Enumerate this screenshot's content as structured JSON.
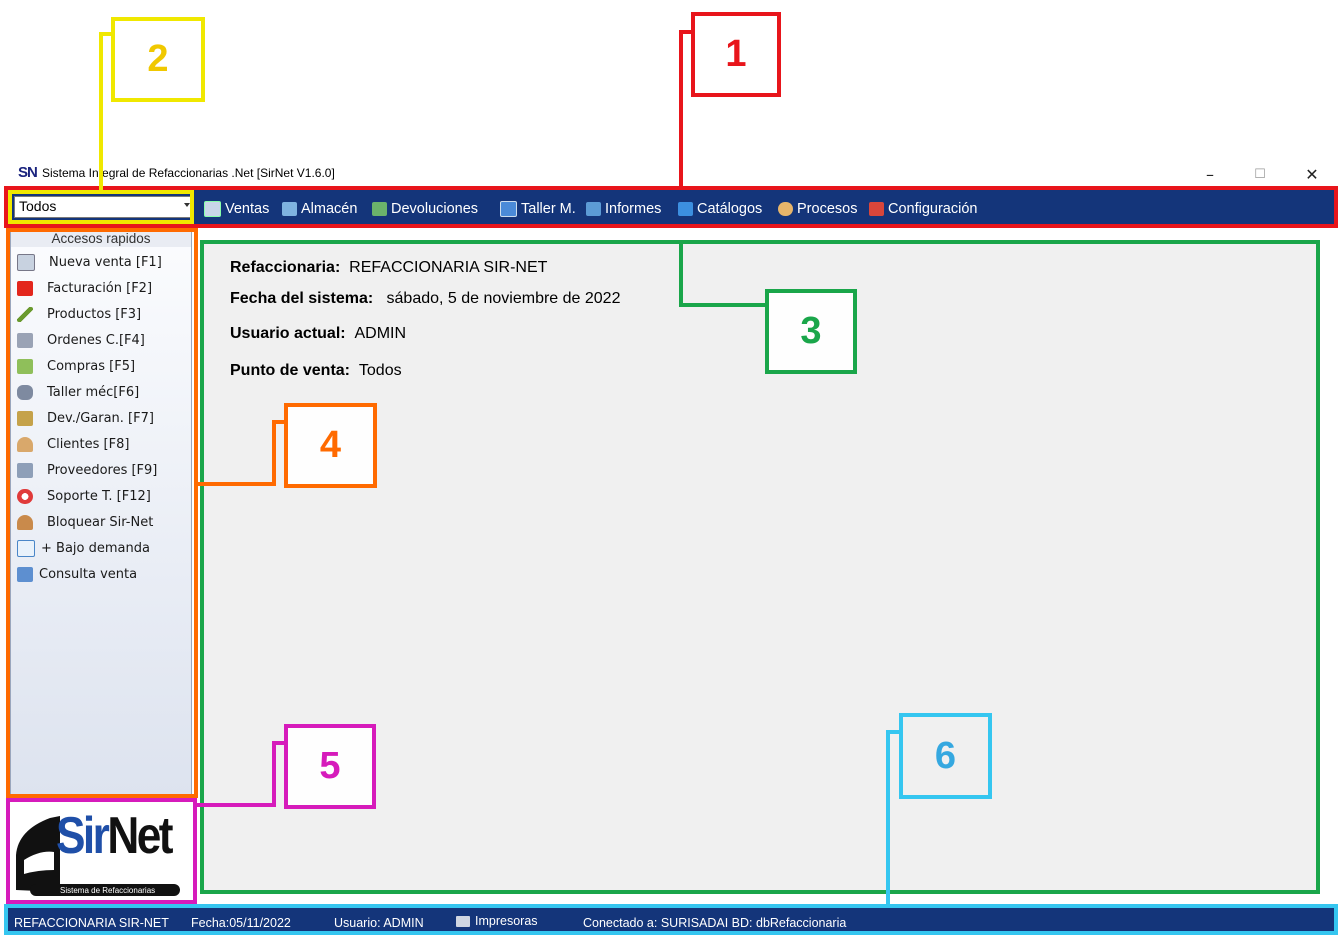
{
  "window": {
    "logo": "SN",
    "title": "Sistema Integral de Refaccionarias .Net [SirNet V1.6.0]",
    "controls": {
      "minimize": "–",
      "maximize": "☐",
      "close": "✕"
    }
  },
  "menubar": {
    "pos_selector": "Todos",
    "items": [
      {
        "label": "Ventas",
        "icon": "ventas-icon"
      },
      {
        "label": "Almacén",
        "icon": "almacen-icon"
      },
      {
        "label": "Devoluciones",
        "icon": "devoluciones-icon"
      },
      {
        "label": "Taller M.",
        "icon": "taller-icon"
      },
      {
        "label": "Informes",
        "icon": "informes-icon"
      },
      {
        "label": "Catálogos",
        "icon": "catalogos-icon"
      },
      {
        "label": "Procesos",
        "icon": "procesos-icon"
      },
      {
        "label": "Configuración",
        "icon": "configuracion-icon"
      }
    ]
  },
  "sidebar": {
    "header": "Accesos rapidos",
    "items": [
      {
        "label": "Nueva venta [F1]",
        "icon": "nueva-venta-icon"
      },
      {
        "label": "Facturación [F2]",
        "icon": "pdf-icon"
      },
      {
        "label": "Productos [F3]",
        "icon": "wrench-icon"
      },
      {
        "label": "Ordenes C.[F4]",
        "icon": "cart-icon"
      },
      {
        "label": "Compras [F5]",
        "icon": "compras-icon"
      },
      {
        "label": "Taller méc[F6]",
        "icon": "car-icon"
      },
      {
        "label": "Dev./Garan. [F7]",
        "icon": "return-cart-icon"
      },
      {
        "label": "Clientes [F8]",
        "icon": "user-icon"
      },
      {
        "label": "Proveedores [F9]",
        "icon": "supplier-icon"
      },
      {
        "label": "Soporte T. [F12]",
        "icon": "lifebuoy-icon"
      },
      {
        "label": "Bloquear Sir-Net",
        "icon": "lock-user-icon"
      },
      {
        "label": "+ Bajo demanda",
        "icon": "demand-icon"
      },
      {
        "label": "Consulta venta",
        "icon": "search-doc-icon"
      }
    ]
  },
  "brand": {
    "name": "SirNet",
    "tagline": "Sistema de Refaccionarias"
  },
  "content": {
    "refaccionaria_label": "Refaccionaria:",
    "refaccionaria_value": "REFACCIONARIA SIR-NET",
    "fecha_label": "Fecha del sistema:",
    "fecha_value": "sábado, 5 de noviembre de 2022",
    "usuario_label": "Usuario actual:",
    "usuario_value": "ADMIN",
    "punto_label": "Punto de venta:",
    "punto_value": "Todos"
  },
  "statusbar": {
    "company": "REFACCIONARIA SIR-NET",
    "fecha": "Fecha:05/11/2022",
    "usuario": "Usuario: ADMIN",
    "impresoras": "Impresoras",
    "conexion": "Conectado a: SURISADAI BD: dbRefaccionaria"
  },
  "annotations": [
    {
      "label": "1",
      "color": "#e8151b"
    },
    {
      "label": "2",
      "color": "#f0e800"
    },
    {
      "label": "3",
      "color": "#1aa64a"
    },
    {
      "label": "4",
      "color": "#ff6a00"
    },
    {
      "label": "5",
      "color": "#d61bbb"
    },
    {
      "label": "6",
      "color": "#35c6f0"
    }
  ]
}
